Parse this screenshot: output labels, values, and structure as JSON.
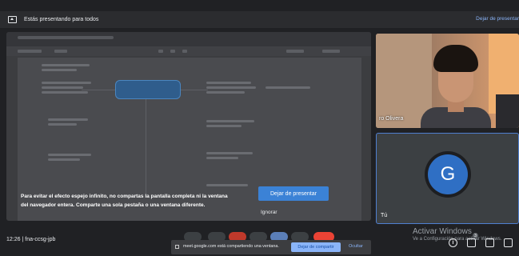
{
  "topbar": {
    "title": "Estás presentando para todos",
    "stop_label": "Dejar de presentar"
  },
  "share": {
    "overlay_message": "Para evitar el efecto espejo infinito, no compartas la pantalla completa ni la ventana del navegador entera. Comparte una sola pestaña o una ventana diferente.",
    "stop_button": "Dejar de presentar",
    "ignore_button": "Ignorar"
  },
  "participants": [
    {
      "name": "ro Olivera",
      "type": "camera"
    },
    {
      "name": "Tú",
      "initial": "G",
      "avatar_color": "#2f6fc4"
    }
  ],
  "bottom": {
    "time": "12:26",
    "separator": "|",
    "meeting_code": "fna-ccsg-jpb",
    "notice_text": "meet.google.com está compartiendo una ventana.",
    "notice_stop": "Dejar de compartir",
    "notice_hide": "Ocultar"
  },
  "watermark": {
    "title": "Activar Windows",
    "subtitle": "Ve a Configuración para activar Windows."
  },
  "badge_count": "3",
  "info_glyph": "i",
  "colors": {
    "accent": "#8ab4f8",
    "primary_button": "#3b82d6",
    "end_call": "#ea4335"
  }
}
